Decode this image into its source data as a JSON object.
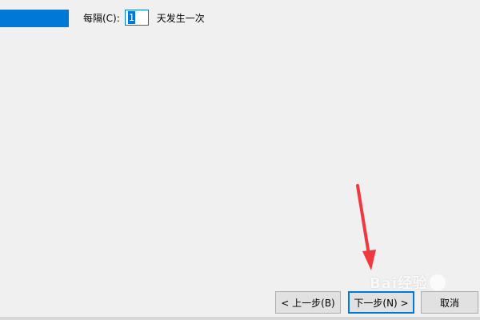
{
  "schedule": {
    "every_label": "每隔(C):",
    "interval_value": "1",
    "unit_label": "天发生一次"
  },
  "buttons": {
    "back": "< 上一步(B)",
    "next": "下一步(N) >",
    "cancel": "取消"
  },
  "annotation": {
    "arrow_color": "#f0393f",
    "watermark_text": "Bai经验"
  },
  "colors": {
    "accent": "#0078d7",
    "background": "#f0f0f0"
  }
}
